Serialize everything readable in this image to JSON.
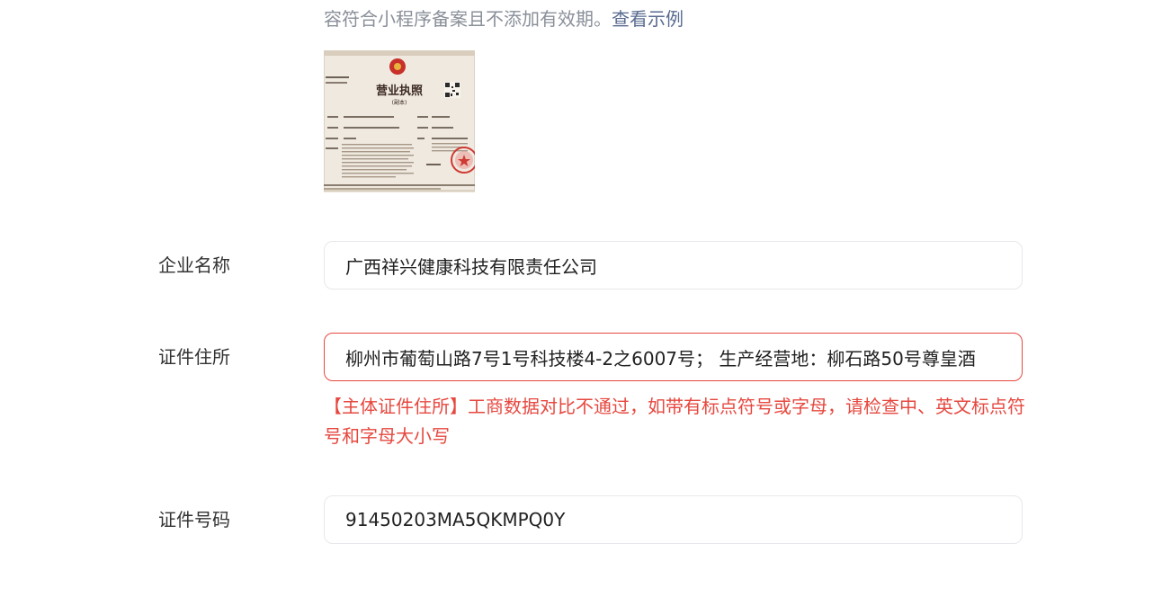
{
  "hint": {
    "text": "容符合小程序备案且不添加有效期。",
    "link": "查看示例"
  },
  "license_image": {
    "title": "营业执照",
    "subtitle": "(副本)"
  },
  "fields": {
    "company_name": {
      "label": "企业名称",
      "value": "广西祥兴健康科技有限责任公司"
    },
    "address": {
      "label": "证件住所",
      "value": "柳州市葡萄山路7号1号科技楼4-2之6007号； 生产经营地：柳石路50号尊皇酒",
      "error": "【主体证件住所】工商数据对比不通过，如带有标点符号或字母，请检查中、英文标点符号和字母大小写"
    },
    "id_number": {
      "label": "证件号码",
      "value": "91450203MA5QKMPQ0Y"
    }
  },
  "colors": {
    "error": "#e6483f",
    "hint": "#8a8f99",
    "link": "#596b8f",
    "border": "#e6e8eb"
  }
}
